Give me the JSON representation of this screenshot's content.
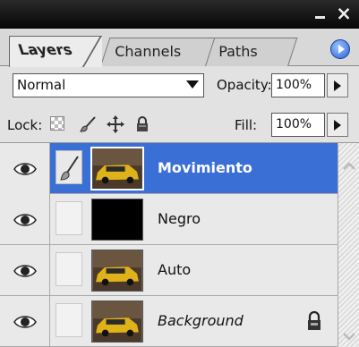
{
  "tabs": [
    {
      "label": "Layers",
      "active": true
    },
    {
      "label": "Channels",
      "active": false
    },
    {
      "label": "Paths",
      "active": false
    }
  ],
  "titlebar": {
    "close_glyph": "×"
  },
  "blend": {
    "mode": "Normal"
  },
  "opacity": {
    "label": "Opacity:",
    "value": "100%"
  },
  "lock": {
    "label": "Lock:"
  },
  "fill": {
    "label": "Fill:",
    "value": "100%"
  },
  "layers": [
    {
      "name": "Movimiento",
      "selected": true,
      "visible": true,
      "thumbnail": "car"
    },
    {
      "name": "Negro",
      "selected": false,
      "visible": true,
      "thumbnail": "black"
    },
    {
      "name": "Auto",
      "selected": false,
      "visible": true,
      "thumbnail": "car"
    },
    {
      "name": "Background",
      "selected": false,
      "visible": true,
      "thumbnail": "car",
      "locked": true
    }
  ],
  "icons": [
    "eye-icon",
    "brush-icon",
    "move-icon",
    "lock-icon",
    "chevron-down-icon",
    "arrow-right-icon",
    "panel-menu-icon"
  ],
  "colors": {
    "selection": "#3a6fd6",
    "titlebar": "#0a0a0a"
  }
}
